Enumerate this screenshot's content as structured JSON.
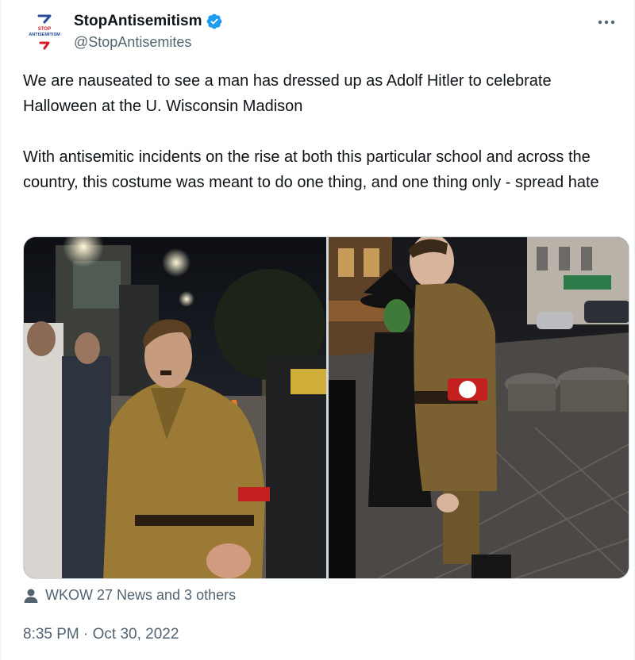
{
  "author": {
    "display_name": "StopAntisemitism",
    "handle": "@StopAntisemites",
    "avatar_icon": "stopantisemitism-logo-icon",
    "verified_icon": "verified-badge-icon",
    "verified_color": "#1d9bf0",
    "logo_text": "STOP ANTISEMITISM"
  },
  "more_icon": "more-options-icon",
  "tweet": {
    "text": "We are nauseated to see a man has dressed up as Adolf Hitler to celebrate Halloween at the U. Wisconsin Madison\n\nWith antisemitic incidents on the rise at both this particular school and across the country, this costume was meant to do one thing, and one thing only - spread hate"
  },
  "media": {
    "photos": [
      {
        "description_icon": "photo-street-night-costume"
      },
      {
        "description_icon": "photo-street-night-costume-second"
      }
    ]
  },
  "tagged": {
    "icon": "person-icon",
    "label": "WKOW 27 News and 3 others"
  },
  "timestamp": "8:35 PM · Oct 30, 2022",
  "colors": {
    "text_primary": "#0f1419",
    "text_secondary": "#536471",
    "border": "#cfd9de",
    "logo_red": "#d0202a",
    "logo_blue": "#2a4a9a"
  }
}
